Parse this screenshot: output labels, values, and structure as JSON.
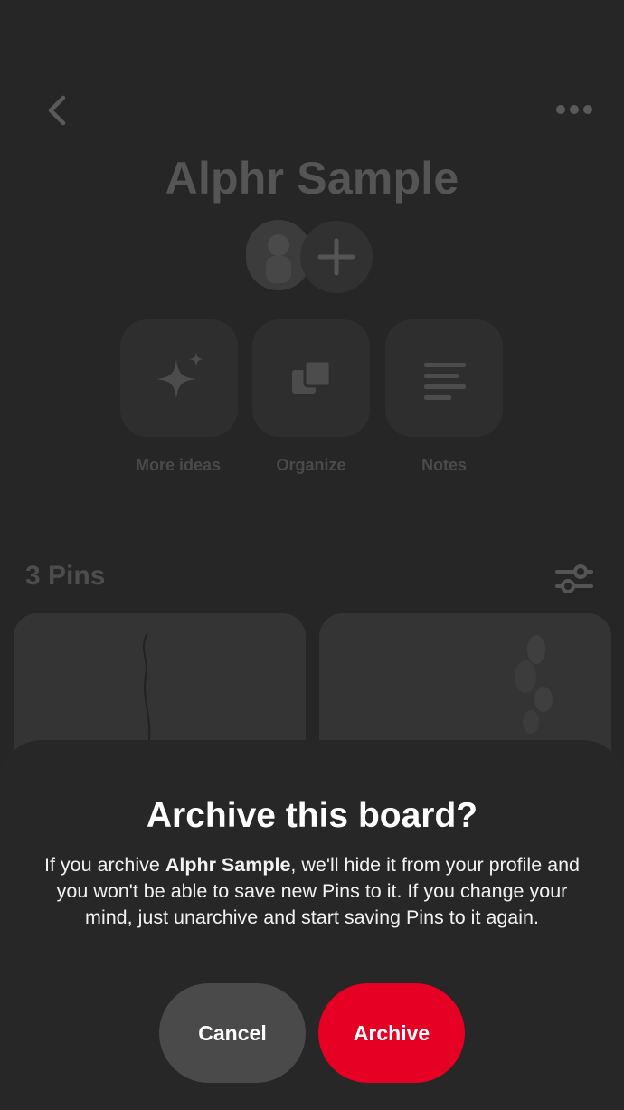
{
  "board": {
    "title": "Alphr Sample",
    "tools": [
      {
        "label": "More ideas",
        "icon": "sparkle-icon"
      },
      {
        "label": "Organize",
        "icon": "organize-icon"
      },
      {
        "label": "Notes",
        "icon": "notes-icon"
      }
    ],
    "pins_count": "3 Pins"
  },
  "dialog": {
    "title": "Archive this board?",
    "body_prefix": "If you archive ",
    "body_board": "Alphr Sample",
    "body_suffix": ", we'll hide it from your profile and you won't be able to save new Pins to it. If you change your mind, just unarchive and start saving Pins to it again.",
    "cancel_label": "Cancel",
    "archive_label": "Archive"
  },
  "colors": {
    "archive_button": "#e60023",
    "cancel_button": "#4a4a4a",
    "sheet_background": "#272727"
  }
}
